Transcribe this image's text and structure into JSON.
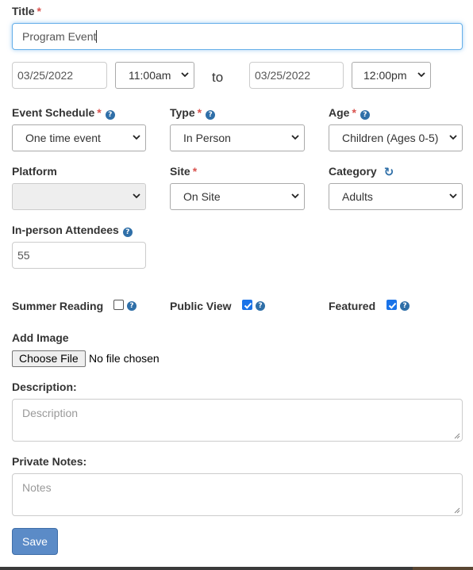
{
  "form": {
    "title": {
      "label": "Title",
      "required": "*",
      "value": "Program Event"
    },
    "dates": {
      "start_date": "03/25/2022",
      "start_time": "11:00am",
      "to_label": "to",
      "end_date": "03/25/2022",
      "end_time": "12:00pm"
    },
    "event_schedule": {
      "label": "Event Schedule",
      "required": "*",
      "value": "One time event"
    },
    "type": {
      "label": "Type",
      "required": "*",
      "value": "In Person"
    },
    "age": {
      "label": "Age",
      "required": "*",
      "value": "Children (Ages 0-5)"
    },
    "platform": {
      "label": "Platform",
      "value": ""
    },
    "site": {
      "label": "Site",
      "required": "*",
      "value": "On Site"
    },
    "category": {
      "label": "Category",
      "value": "Adults"
    },
    "attendees": {
      "label": "In-person Attendees",
      "value": "55"
    },
    "summer_reading": {
      "label": "Summer Reading",
      "checked": false
    },
    "public_view": {
      "label": "Public View",
      "checked": true
    },
    "featured": {
      "label": "Featured",
      "checked": true
    },
    "add_image": {
      "label": "Add Image",
      "button": "Choose File",
      "status": "No file chosen"
    },
    "description": {
      "label": "Description:",
      "placeholder": "Description"
    },
    "private_notes": {
      "label": "Private Notes:",
      "placeholder": "Notes"
    },
    "save_label": "Save"
  },
  "icons": {
    "help": "question-circle-icon",
    "refresh": "refresh-icon",
    "dropdown": "chevron-down-icon"
  },
  "colors": {
    "primary_button": "#5b8bc7",
    "required": "#d9534f",
    "help_icon": "#2f6fa8",
    "checkbox_checked": "#1a73e8",
    "focus_border": "#66afe9"
  }
}
